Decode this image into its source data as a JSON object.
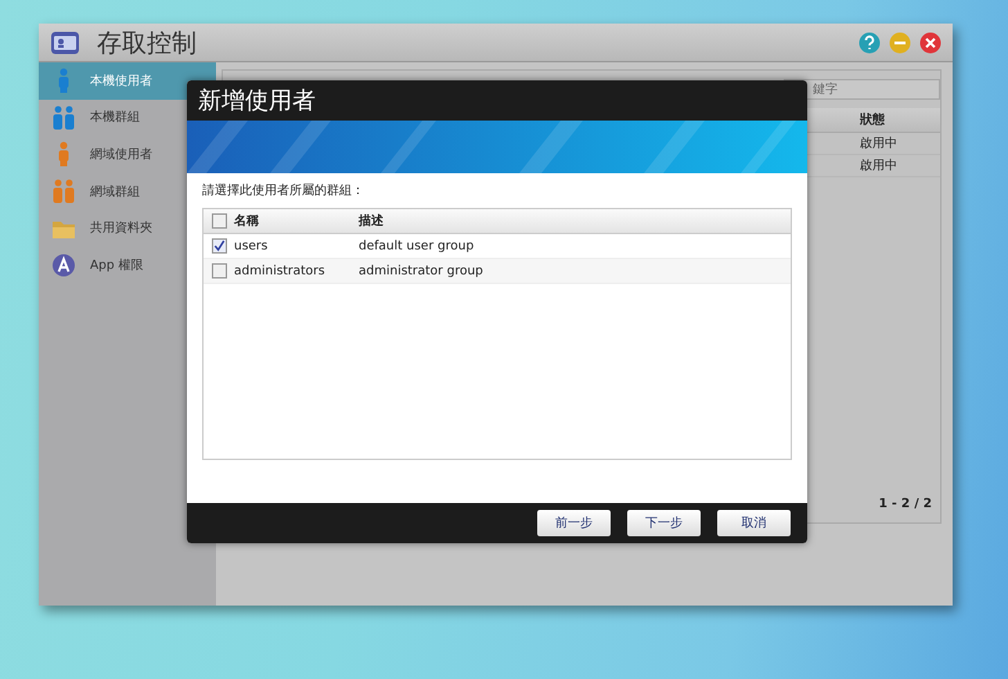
{
  "window": {
    "title": "存取控制"
  },
  "sidebar": {
    "items": [
      {
        "label": "本機使用者",
        "kind": "user",
        "selected": true
      },
      {
        "label": "本機群組",
        "kind": "group",
        "selected": false
      },
      {
        "label": "網域使用者",
        "kind": "domain_user",
        "selected": false
      },
      {
        "label": "網域群組",
        "kind": "domain_group",
        "selected": false
      },
      {
        "label": "共用資料夾",
        "kind": "folder",
        "selected": false
      },
      {
        "label": "App 權限",
        "kind": "app",
        "selected": false
      }
    ]
  },
  "search": {
    "placeholder": "鍵字"
  },
  "table": {
    "columns": [
      "狀態"
    ],
    "rows": [
      [
        "啟用中"
      ],
      [
        "啟用中"
      ]
    ]
  },
  "pagination": "1 - 2 / 2",
  "dialog": {
    "title": "新增使用者",
    "prompt": "請選擇此使用者所屬的群組：",
    "select_all": {
      "checked": false
    },
    "columns": [
      "名稱",
      "描述"
    ],
    "rows": [
      {
        "name": "users",
        "description": "default user group",
        "checked": true
      },
      {
        "name": "administrators",
        "description": "administrator group",
        "checked": false
      }
    ],
    "buttons": [
      "前一步",
      "下一步",
      "取消"
    ]
  }
}
